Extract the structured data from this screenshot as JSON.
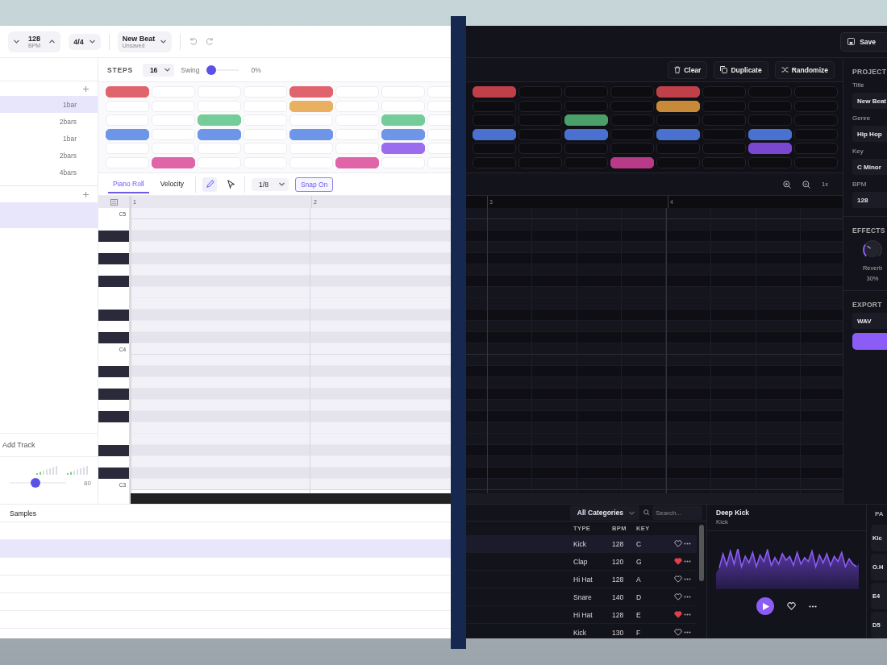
{
  "light": {
    "toolbar": {
      "bpm": {
        "value": "128",
        "unit": "BPM"
      },
      "time_signature": "4/4",
      "project": {
        "name": "New Beat",
        "status": "Unsaved"
      }
    },
    "patterns": [
      {
        "length": "1bar",
        "selected": true
      },
      {
        "length": "2bars",
        "selected": false
      },
      {
        "length": "1bar",
        "selected": false
      },
      {
        "length": "2bars",
        "selected": false
      },
      {
        "length": "4bars",
        "selected": false
      }
    ],
    "tracks": [
      {
        "selected": true
      }
    ],
    "add_track": "Add Track",
    "master": {
      "level": 0.45,
      "reading": "80"
    },
    "steps": {
      "label": "STEPS",
      "count": "16",
      "swing": {
        "label": "Swing",
        "level": 0,
        "reading": "0%"
      }
    },
    "step_rows": [
      {
        "color": "#e0646e",
        "steps": [
          true,
          false,
          false,
          false,
          true,
          false,
          false,
          false
        ]
      },
      {
        "color": "#e8b060",
        "steps": [
          false,
          false,
          false,
          false,
          true,
          false,
          false,
          false
        ]
      },
      {
        "color": "#74cc98",
        "steps": [
          false,
          false,
          true,
          false,
          false,
          false,
          true,
          false
        ]
      },
      {
        "color": "#6e96e8",
        "steps": [
          true,
          false,
          true,
          false,
          true,
          false,
          true,
          false
        ]
      },
      {
        "color": "#9b6ced",
        "steps": [
          false,
          false,
          false,
          false,
          false,
          false,
          true,
          false
        ]
      },
      {
        "color": "#e064a8",
        "steps": [
          false,
          true,
          false,
          false,
          false,
          true,
          false,
          false
        ]
      }
    ],
    "piano_tabs": [
      {
        "label": "Piano Roll",
        "selected": true
      },
      {
        "label": "Velocity",
        "selected": false
      }
    ],
    "tools": [
      {
        "kind": "pencil",
        "selected": true
      },
      {
        "kind": "pointer",
        "selected": false
      }
    ],
    "grid": "1/8",
    "snap": {
      "label": "Snap On",
      "on": true
    },
    "piano_roll": {
      "bars": [
        "1",
        "2"
      ],
      "octave_labels": [
        "C5",
        "C4",
        "C3"
      ]
    },
    "samples": {
      "tab": "Samples",
      "rows": [
        {
          "selected": false
        },
        {
          "selected": true
        },
        {
          "selected": false
        },
        {
          "selected": false
        },
        {
          "selected": false
        },
        {
          "selected": false
        }
      ]
    }
  },
  "dark": {
    "save": "Save",
    "actions": [
      {
        "kind": "clear",
        "label": "Clear"
      },
      {
        "kind": "duplicate",
        "label": "Duplicate"
      },
      {
        "kind": "randomize",
        "label": "Randomize"
      }
    ],
    "step_rows": [
      {
        "color": "#c0404a",
        "steps": [
          true,
          false,
          false,
          false,
          true,
          false,
          false,
          false
        ]
      },
      {
        "color": "#c88a38",
        "steps": [
          false,
          false,
          false,
          false,
          true,
          false,
          false,
          false
        ]
      },
      {
        "color": "#4aa068",
        "steps": [
          false,
          false,
          true,
          false,
          false,
          false,
          false,
          false
        ]
      },
      {
        "color": "#4a70d0",
        "steps": [
          true,
          false,
          true,
          false,
          true,
          false,
          true,
          false
        ]
      },
      {
        "color": "#7a48d0",
        "steps": [
          false,
          false,
          false,
          false,
          false,
          false,
          true,
          false
        ]
      },
      {
        "color": "#b83a88",
        "steps": [
          false,
          false,
          false,
          true,
          false,
          false,
          false,
          false
        ]
      }
    ],
    "zoom_reading": "1x",
    "piano_roll": {
      "bars": [
        "3",
        "4"
      ]
    },
    "project": {
      "title": "PROJECT",
      "fields": [
        {
          "label": "Title",
          "value": "New Beat"
        },
        {
          "label": "Genre",
          "value": "Hip Hop"
        },
        {
          "label": "Key",
          "value": "C Minor"
        },
        {
          "label": "BPM",
          "value": "128"
        }
      ]
    },
    "effects": {
      "title": "EFFECTS",
      "knobs": [
        {
          "label": "Reverb",
          "level": 0.3,
          "reading": "30%"
        }
      ]
    },
    "export": {
      "title": "EXPORT",
      "format": "WAV"
    },
    "browser": {
      "category": "All Categories",
      "search_placeholder": "Search...",
      "columns": [
        "TYPE",
        "BPM",
        "KEY"
      ],
      "rows": [
        {
          "type": "Kick",
          "bpm": "128",
          "key": "C",
          "favorite": false,
          "selected": true
        },
        {
          "type": "Clap",
          "bpm": "120",
          "key": "G",
          "favorite": true,
          "selected": false
        },
        {
          "type": "Hi Hat",
          "bpm": "128",
          "key": "A",
          "favorite": false,
          "selected": false
        },
        {
          "type": "Snare",
          "bpm": "140",
          "key": "D",
          "favorite": false,
          "selected": false
        },
        {
          "type": "Hi Hat",
          "bpm": "128",
          "key": "E",
          "favorite": true,
          "selected": false
        },
        {
          "type": "Kick",
          "bpm": "130",
          "key": "F",
          "favorite": false,
          "selected": false
        }
      ]
    },
    "preview": {
      "name": "Deep Kick",
      "type": "Kick"
    },
    "pads": {
      "title": "PA",
      "items": [
        "Kic",
        "O.H",
        "E4",
        "D5"
      ]
    }
  }
}
